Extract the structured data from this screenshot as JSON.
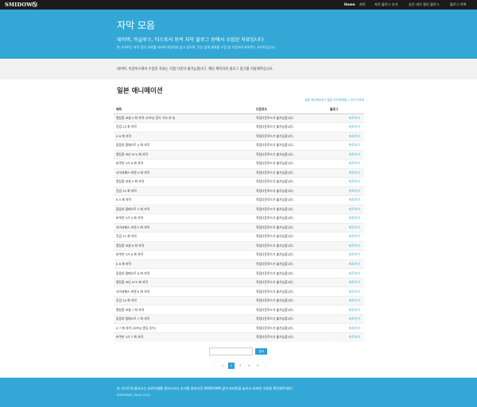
{
  "navbar": {
    "brand": "SMIDOWN",
    "brand_icon": "gear-icon",
    "items": [
      {
        "label": "Home",
        "active": true
      },
      {
        "label": "자막"
      },
      {
        "label": "자막 블로그 추가"
      },
      {
        "label": "송간 대기 중인 블로그"
      },
      {
        "label": "블로그 목록"
      }
    ]
  },
  "hero": {
    "title": "자막 모음",
    "subtitle": "네이버, 이글루스, 티스토리 등의 자막 블로그 등에서 수집된 자료입니다",
    "description": "본 사이트는 자막 등의 자료를 서버에 저장하지 않고 있으며, 단순 검색 결과를 수집 및 가공하여 보여주는 사이트입니다."
  },
  "notice": "네이버, 이글루스에서 수집된 자료는 직접 다운이 불가능합니다. 해당 제작자의 블로그 링크를 이용해주십시오.",
  "section_title": "일본 애니메이션",
  "filter_links": "일본 애니메이션 | 일본 드라마/예능 | 미국 드라마",
  "table": {
    "headers": [
      "제목",
      "다운로드",
      "블로그"
    ],
    "rows": [
      {
        "title": "명탐정 코넬 4 화 자막 (오프닝 정식 가사 추가)",
        "download": "직접다운로드가 불가능합니다.",
        "link": "바로가기"
      },
      {
        "title": "진검 23 화 자막",
        "download": "직접다운로드가 불가능합니다.",
        "link": "바로가기"
      },
      {
        "title": "K 6 화 자막",
        "download": "직접다운로드가 불가능합니다.",
        "link": "바로가기"
      },
      {
        "title": "잡음의 펌페스트 4 화 자막",
        "download": "직접다운로드가 불가능합니다.",
        "link": "바로가기"
      },
      {
        "title": "명탐정 코난 674 화 자막",
        "download": "직접다운로드가 불가능합니다.",
        "link": "바로가기"
      },
      {
        "title": "바쿠만 3기 6 화 자막",
        "download": "직접다운로드가 불가능합니다.",
        "link": "바로가기"
      },
      {
        "title": "사이코패스 포텐 4 화 자막",
        "download": "직접다운로드가 불가능합니다.",
        "link": "바로가기"
      },
      {
        "title": "명탐정 코넬 5 화 자막",
        "download": "직접다운로드가 불가능합니다.",
        "link": "바로가기"
      },
      {
        "title": "진검 22 화 자막",
        "download": "직접다운로드가 불가능합니다.",
        "link": "바로가기"
      },
      {
        "title": "K 5 화 자막",
        "download": "직접다운로드가 불가능합니다.",
        "link": "바로가기"
      },
      {
        "title": "잡음의 펌페스트 5 화 자막",
        "download": "직접다운로드가 불가능합니다.",
        "link": "바로가기"
      },
      {
        "title": "바쿠만 3기 5 화 자막",
        "download": "직접다운로드가 불가능합니다.",
        "link": "바로가기"
      },
      {
        "title": "사이코패스 포텐 5 화 자막",
        "download": "직접다운로드가 불가능합니다.",
        "link": "바로가기"
      },
      {
        "title": "진검 21 화 자막",
        "download": "직접다운로드가 불가능합니다.",
        "link": "바로가기"
      },
      {
        "title": "명탐정 코넬 6 화 자막",
        "download": "직접다운로드가 불가능합니다.",
        "link": "바로가기"
      },
      {
        "title": "바쿠만 3기 6 화 자막",
        "download": "직접다운로드가 불가능합니다.",
        "link": "바로가기"
      },
      {
        "title": "K 6 화 자막",
        "download": "직접다운로드가 불가능합니다.",
        "link": "바로가기"
      },
      {
        "title": "잡음의 펌페스트 6 화 자막",
        "download": "직접다운로드가 불가능합니다.",
        "link": "바로가기"
      },
      {
        "title": "명탐정 코난 675 화 자막",
        "download": "직접다운로드가 불가능합니다.",
        "link": "바로가기"
      },
      {
        "title": "사이코패스 포텐 6 화 자막",
        "download": "직접다운로드가 불가능합니다.",
        "link": "바로가기"
      },
      {
        "title": "진검 24 화 자막",
        "download": "직접다운로드가 불가능합니다.",
        "link": "바로가기"
      },
      {
        "title": "명탐정 코넬 7 화 자막",
        "download": "직접다운로드가 불가능합니다.",
        "link": "바로가기"
      },
      {
        "title": "잡음의 펌페스트 7 화 자막",
        "download": "직접다운로드가 불가능합니다.",
        "link": "바로가기"
      },
      {
        "title": "K 7 화 자막 (오프닝 엔딩 추가)",
        "download": "직접다운로드가 불가능합니다.",
        "link": "바로가기"
      },
      {
        "title": "바쿠만 3기 7 화 자막",
        "download": "직접다운로드가 불가능합니다.",
        "link": "바로가기"
      }
    ]
  },
  "search": {
    "value": "",
    "button_label": "검색"
  },
  "pagination": {
    "prev": "‹",
    "pages": [
      "1",
      "2",
      "3",
      "4",
      "5"
    ],
    "current": "2",
    "next": "›"
  },
  "footer": {
    "text": "본 사이트에 올라오는 자료삭제를 원하시거나 추가를 원하시면 SMIDOWN 앞의 ⚙버튼을 눌러서 자세한 사항을 확인해주세요!",
    "copyright": "SMIDOWN | Since 2013"
  },
  "colors": {
    "accent": "#33a8d6",
    "link": "#2a9fd6",
    "navbar": "#1b1b1b"
  }
}
